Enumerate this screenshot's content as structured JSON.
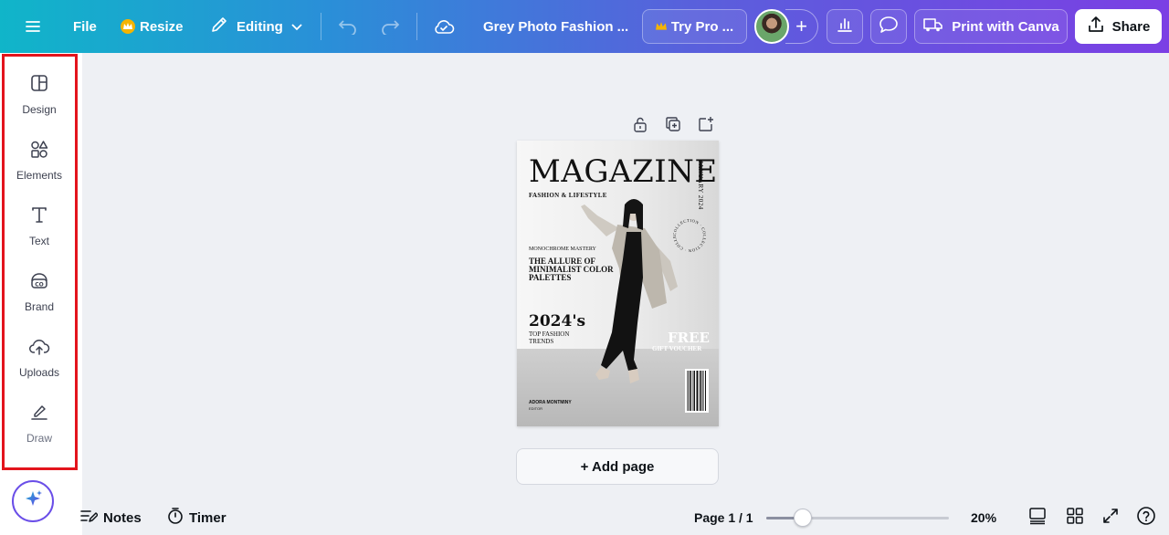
{
  "topbar": {
    "file_label": "File",
    "resize_label": "Resize",
    "editing_label": "Editing",
    "doc_title": "Grey Photo Fashion ...",
    "try_pro_label": "Try Pro ...",
    "print_label": "Print with Canva",
    "share_label": "Share"
  },
  "sidebar": {
    "items": [
      {
        "label": "Design",
        "icon": "layout-icon"
      },
      {
        "label": "Elements",
        "icon": "shapes-icon"
      },
      {
        "label": "Text",
        "icon": "text-icon"
      },
      {
        "label": "Brand",
        "icon": "brand-icon"
      },
      {
        "label": "Uploads",
        "icon": "cloud-upload-icon"
      },
      {
        "label": "Draw",
        "icon": "pen-icon"
      }
    ]
  },
  "cover": {
    "title": "MAGAZINE",
    "subtitle": "FASHION & LIFESTYLE",
    "date": "JANUARY 2024",
    "ring_text": "COLLECTION · COLLECTION · COLLECTION ·",
    "small_heading": "MONOCHROME MASTERY",
    "headline": "THE ALLURE OF MINIMALIST COLOR PALETTES",
    "year": "2024's",
    "trends": "TOP FASHION TRENDS",
    "free": "FREE",
    "gift": "GIFT VOUCHER",
    "editor_name": "ADORA MONTMINY",
    "editor_role": "EDITOR"
  },
  "canvas": {
    "add_page_label": "+ Add page"
  },
  "bottombar": {
    "notes_label": "Notes",
    "timer_label": "Timer",
    "page_indicator": "Page 1 / 1",
    "zoom_value": 20,
    "zoom_label": "20%"
  },
  "colors": {
    "accent": "#7b3fe4",
    "highlight": "#e3141c",
    "gradient_start": "#10b5c9",
    "gradient_end": "#7b3fe4"
  }
}
